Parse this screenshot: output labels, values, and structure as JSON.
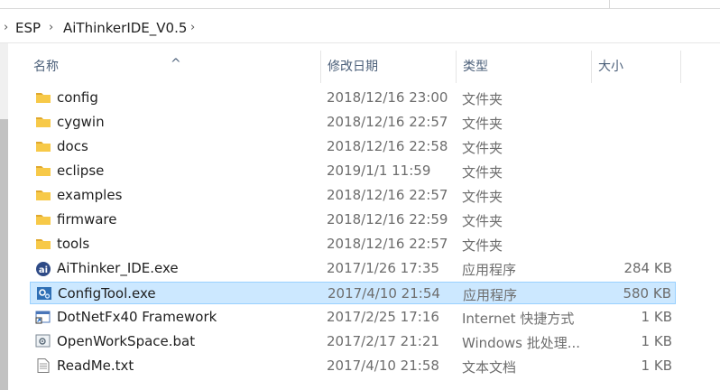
{
  "breadcrumb": {
    "items": [
      {
        "label": "ESP"
      },
      {
        "label": "AiThinkerIDE_V0.5"
      }
    ]
  },
  "columns": {
    "name": "名称",
    "date": "修改日期",
    "type": "类型",
    "size": "大小"
  },
  "files": [
    {
      "name": "config",
      "date": "2018/12/16 23:00",
      "type": "文件夹",
      "size": "",
      "icon": "folder-icon"
    },
    {
      "name": "cygwin",
      "date": "2018/12/16 22:57",
      "type": "文件夹",
      "size": "",
      "icon": "folder-icon"
    },
    {
      "name": "docs",
      "date": "2018/12/16 22:58",
      "type": "文件夹",
      "size": "",
      "icon": "folder-icon"
    },
    {
      "name": "eclipse",
      "date": "2019/1/1 11:59",
      "type": "文件夹",
      "size": "",
      "icon": "folder-icon"
    },
    {
      "name": "examples",
      "date": "2018/12/16 22:57",
      "type": "文件夹",
      "size": "",
      "icon": "folder-icon"
    },
    {
      "name": "firmware",
      "date": "2018/12/16 22:59",
      "type": "文件夹",
      "size": "",
      "icon": "folder-icon"
    },
    {
      "name": "tools",
      "date": "2018/12/16 22:57",
      "type": "文件夹",
      "size": "",
      "icon": "folder-icon"
    },
    {
      "name": "AiThinker_IDE.exe",
      "date": "2017/1/26 17:35",
      "type": "应用程序",
      "size": "284 KB",
      "icon": "aithinker-app-icon"
    },
    {
      "name": "ConfigTool.exe",
      "date": "2017/4/10 21:54",
      "type": "应用程序",
      "size": "580 KB",
      "icon": "gear-app-icon",
      "selected": true
    },
    {
      "name": "DotNetFx40 Framework",
      "date": "2017/2/25 17:16",
      "type": "Internet 快捷方式",
      "size": "1 KB",
      "icon": "internet-shortcut-icon"
    },
    {
      "name": "OpenWorkSpace.bat",
      "date": "2017/2/17 21:21",
      "type": "Windows 批处理...",
      "size": "1 KB",
      "icon": "batch-file-icon"
    },
    {
      "name": "ReadMe.txt",
      "date": "2017/4/10 21:58",
      "type": "文本文档",
      "size": "1 KB",
      "icon": "text-file-icon"
    }
  ],
  "colors": {
    "selection_bg": "#cce8ff",
    "selection_border": "#99d1ff",
    "folder": "#f7c948",
    "header_text": "#4c607a"
  }
}
